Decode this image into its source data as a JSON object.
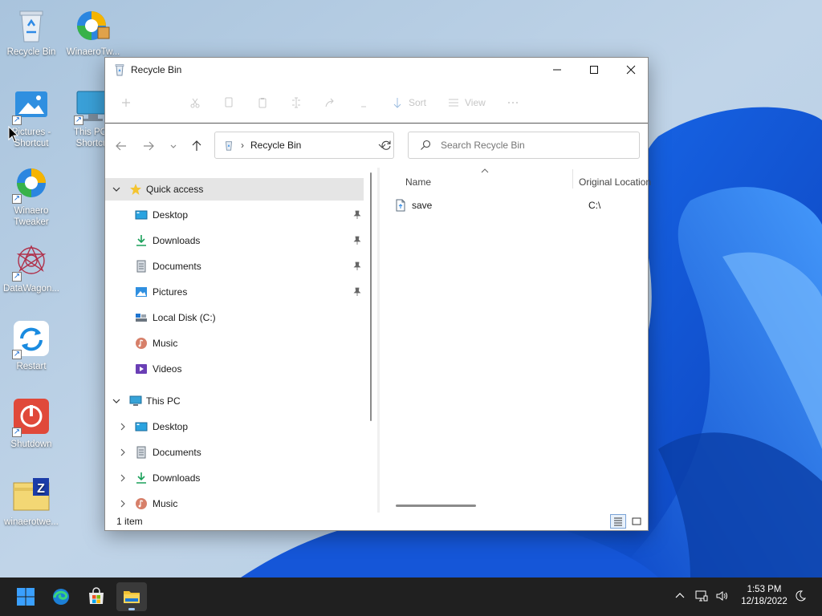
{
  "desktop": {
    "icons": [
      {
        "label": "Recycle Bin",
        "icon": "recycle-bin-icon",
        "shortcut": false
      },
      {
        "label": "WinaeroTw...",
        "icon": "winaero-tweaker-icon",
        "shortcut": false
      },
      {
        "label": "Pictures - Shortcut",
        "icon": "pictures-folder-icon",
        "shortcut": true
      },
      {
        "label": "This PC - Shortcut",
        "icon": "this-pc-icon",
        "shortcut": true
      },
      {
        "label": "Winaero Tweaker",
        "icon": "winaero-tweaker-icon",
        "shortcut": true
      },
      {
        "label": "DataWagon...",
        "icon": "datawagon-icon",
        "shortcut": true
      },
      {
        "label": "Restart",
        "icon": "restart-icon",
        "shortcut": true
      },
      {
        "label": "Shutdown",
        "icon": "shutdown-icon",
        "shortcut": true
      },
      {
        "label": "winaerotwe...",
        "icon": "zip-archive-icon",
        "shortcut": false
      }
    ]
  },
  "window": {
    "title": "Recycle Bin",
    "controls": {
      "minimize": "minimize-icon",
      "maximize": "maximize-icon",
      "close": "close-icon"
    },
    "commandbar": {
      "items": [
        {
          "icon": "new-icon",
          "label": ""
        },
        {
          "icon": "cut-icon",
          "label": ""
        },
        {
          "icon": "copy-icon",
          "label": ""
        },
        {
          "icon": "paste-icon",
          "label": ""
        },
        {
          "icon": "rename-icon",
          "label": ""
        },
        {
          "icon": "share-icon",
          "label": ""
        },
        {
          "icon": "delete-icon",
          "label": ""
        },
        {
          "icon": "sort-icon",
          "label": "Sort"
        },
        {
          "icon": "view-icon",
          "label": "View"
        },
        {
          "icon": "more-icon",
          "label": ""
        }
      ]
    },
    "address": {
      "location": "Recycle Bin",
      "search_placeholder": "Search Recycle Bin"
    },
    "navpane": {
      "quick_access": {
        "label": "Quick access",
        "expanded": true,
        "selected": true
      },
      "quick_items": [
        {
          "label": "Desktop",
          "icon": "desktop-icon",
          "pinned": true
        },
        {
          "label": "Downloads",
          "icon": "downloads-icon",
          "pinned": true
        },
        {
          "label": "Documents",
          "icon": "documents-icon",
          "pinned": true
        },
        {
          "label": "Pictures",
          "icon": "pictures-icon",
          "pinned": true
        },
        {
          "label": "Local Disk (C:)",
          "icon": "local-disk-icon",
          "pinned": false
        },
        {
          "label": "Music",
          "icon": "music-icon",
          "pinned": false
        },
        {
          "label": "Videos",
          "icon": "videos-icon",
          "pinned": false
        }
      ],
      "this_pc": {
        "label": "This PC",
        "expanded": true
      },
      "this_pc_items": [
        {
          "label": "Desktop",
          "icon": "desktop-icon"
        },
        {
          "label": "Documents",
          "icon": "documents-icon"
        },
        {
          "label": "Downloads",
          "icon": "downloads-icon"
        },
        {
          "label": "Music",
          "icon": "music-icon"
        }
      ]
    },
    "content": {
      "columns": [
        "Name",
        "Original Location"
      ],
      "sorted_by": "Name",
      "rows": [
        {
          "name": "save",
          "original_location": "C:\\",
          "icon": "file-icon"
        }
      ]
    },
    "status": {
      "item_count": "1 item",
      "active_view": "details"
    }
  },
  "taskbar": {
    "apps": [
      {
        "name": "start",
        "icon": "windows-start-icon",
        "active": false
      },
      {
        "name": "edge",
        "icon": "edge-icon",
        "active": false
      },
      {
        "name": "store",
        "icon": "store-icon",
        "active": false
      },
      {
        "name": "file-explorer",
        "icon": "file-explorer-icon",
        "active": true
      }
    ],
    "tray": [
      "chevron-up-icon",
      "network-icon",
      "volume-icon",
      "moon-icon"
    ],
    "clock": {
      "time": "1:53 PM",
      "date": "12/18/2022"
    }
  },
  "colors": {
    "accent": "#0067c0",
    "taskbar": "#202020",
    "selection": "#e5e5e5",
    "folder": "#f2c233"
  }
}
